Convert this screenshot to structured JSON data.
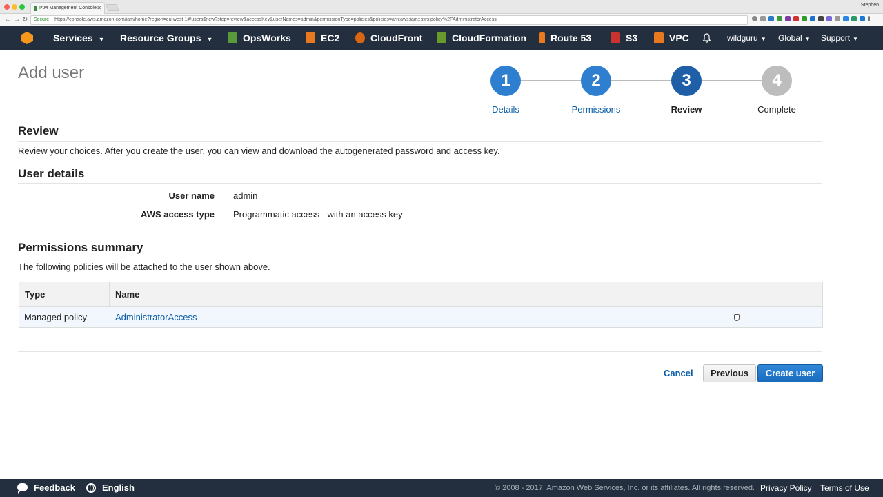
{
  "browser": {
    "tab_title": "IAM Management Console",
    "tab_close": "✕",
    "profile_name": "Stephen",
    "secure_label": "Secure",
    "url": "https://console.aws.amazon.com/iam/home?region=eu-west-1#/users$new?step=review&accessKey&userNames=admin&permissionType=policies&policies=arn:aws:iam::aws:policy%2FAdministratorAccess"
  },
  "nav": {
    "services": "Services",
    "resource_groups": "Resource Groups",
    "opsworks": "OpsWorks",
    "ec2": "EC2",
    "cloudfront": "CloudFront",
    "cloudformation": "CloudFormation",
    "route53": "Route 53",
    "s3": "S3",
    "vpc": "VPC",
    "account": "wildguru",
    "region": "Global",
    "support": "Support"
  },
  "page": {
    "title": "Add user"
  },
  "steps": [
    {
      "number": "1",
      "label": "Details",
      "state": "done"
    },
    {
      "number": "2",
      "label": "Permissions",
      "state": "done"
    },
    {
      "number": "3",
      "label": "Review",
      "state": "current"
    },
    {
      "number": "4",
      "label": "Complete",
      "state": "pending"
    }
  ],
  "review": {
    "heading": "Review",
    "description": "Review your choices. After you create the user, you can view and download the autogenerated password and access key."
  },
  "user_details": {
    "heading": "User details",
    "user_name_label": "User name",
    "user_name_value": "admin",
    "access_type_label": "AWS access type",
    "access_type_value": "Programmatic access - with an access key"
  },
  "permissions": {
    "heading": "Permissions summary",
    "description": "The following policies will be attached to the user shown above.",
    "columns": [
      "Type",
      "Name"
    ],
    "rows": [
      {
        "type": "Managed policy",
        "name": "AdministratorAccess"
      }
    ]
  },
  "actions": {
    "cancel": "Cancel",
    "previous": "Previous",
    "create": "Create user"
  },
  "footer": {
    "feedback": "Feedback",
    "language": "English",
    "copyright": "© 2008 - 2017, Amazon Web Services, Inc. or its affiliates. All rights reserved.",
    "privacy": "Privacy Policy",
    "terms": "Terms of Use"
  },
  "colors": {
    "step_done": "#2e7fcf",
    "step_current": "#1f5fa8",
    "step_pending": "#bdbdbd",
    "nav_bg": "#232f3e",
    "link": "#0b5ea8"
  }
}
